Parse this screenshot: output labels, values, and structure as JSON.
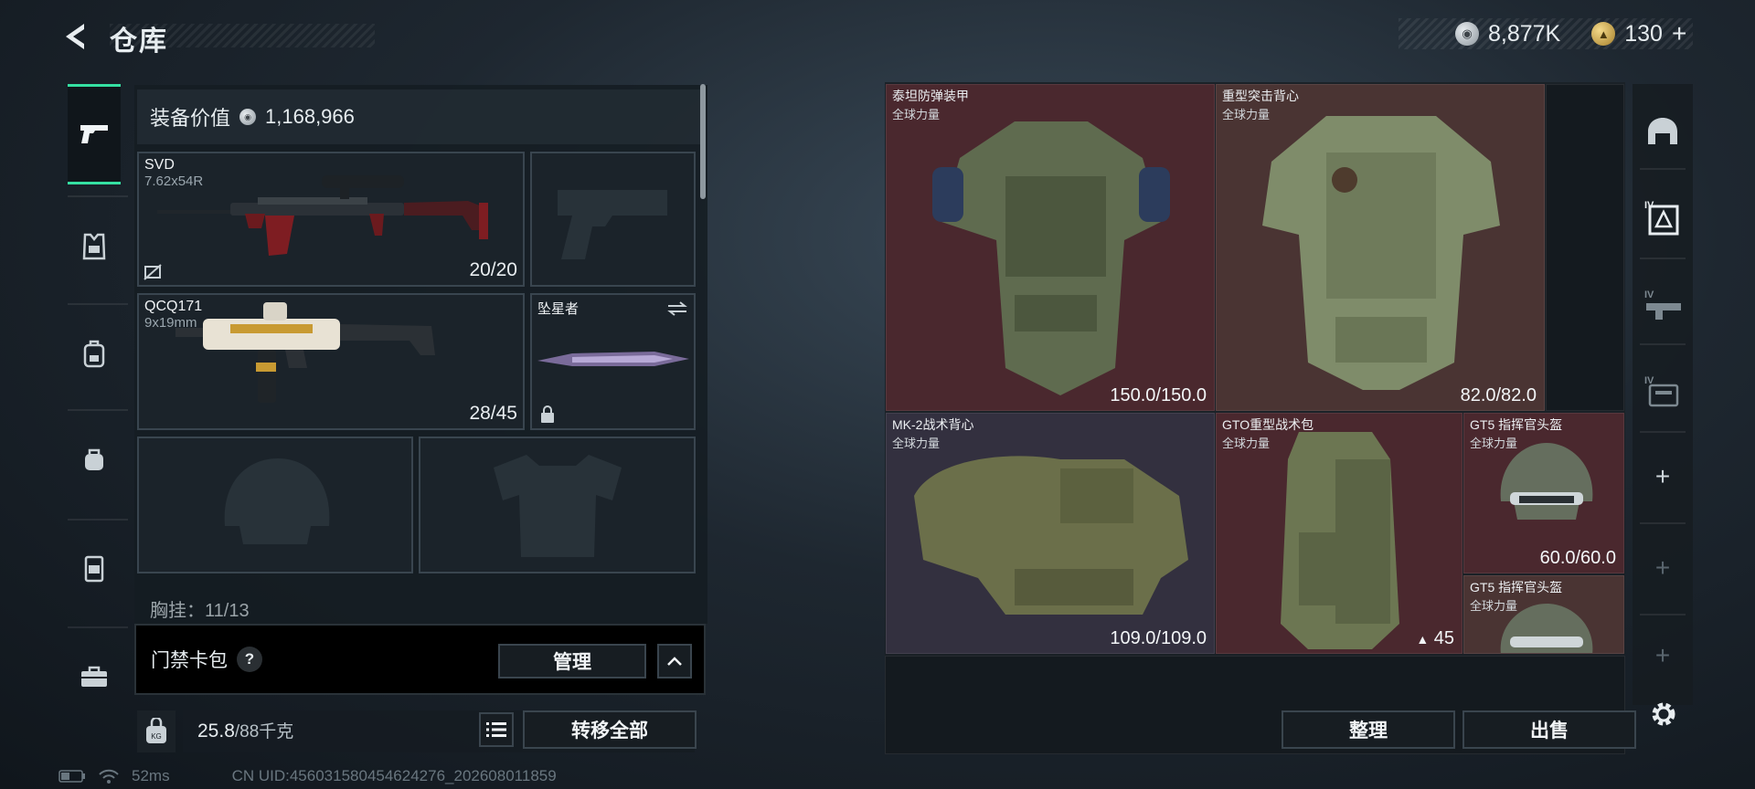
{
  "header": {
    "title": "仓库",
    "currency": [
      {
        "icon": "silver-coin-icon",
        "value": "8,877K"
      },
      {
        "icon": "gold-coin-icon",
        "value": "130"
      }
    ],
    "add_symbol": "+"
  },
  "sidebar": {
    "categories": [
      {
        "icon": "pistol-icon",
        "active": true
      },
      {
        "icon": "armor-vest-icon",
        "active": false
      },
      {
        "icon": "backpack-icon",
        "active": false
      },
      {
        "icon": "pouch-icon",
        "active": false
      },
      {
        "icon": "chest-rig-icon",
        "active": false
      },
      {
        "icon": "toolbox-icon",
        "active": false
      }
    ]
  },
  "loadout": {
    "value_label": "装备价值",
    "value": "1,168,966",
    "primary": {
      "name": "SVD",
      "caliber": "7.62x54R",
      "ammo": "20/20"
    },
    "secondary": {
      "name": "QCQ171",
      "caliber": "9x19mm",
      "ammo": "28/45"
    },
    "melee": {
      "name": "坠星者"
    },
    "chest_label": "胸挂：11/13"
  },
  "keycard": {
    "label": "门禁卡包",
    "help": "?",
    "manage_label": "管理"
  },
  "footer": {
    "weight": "25.8",
    "weight_cap": "/88千克",
    "transfer_label": "转移全部"
  },
  "status": {
    "ping": "52ms",
    "uid": "CN UID:456031580454624276_202608011859"
  },
  "inventory": {
    "items": [
      {
        "name": "泰坦防弹装甲",
        "region": "全球力量",
        "durability": "150.0/150.0"
      },
      {
        "name": "重型突击背心",
        "region": "全球力量",
        "durability": "82.0/82.0"
      },
      {
        "name": "MK-2战术背心",
        "region": "全球力量",
        "durability": "109.0/109.0"
      },
      {
        "name": "GTO重型战术包",
        "region": "全球力量",
        "count": "45"
      },
      {
        "name": "GT5 指挥官头盔",
        "region": "全球力量",
        "durability": "60.0/60.0"
      },
      {
        "name": "GT5 指挥官头盔",
        "region": "全球力量"
      }
    ],
    "sort_label": "整理",
    "sell_label": "出售"
  },
  "filters": {
    "items": [
      {
        "icon": "helmet-filter-icon"
      },
      {
        "icon": "armor-filter-icon",
        "tier": "IV"
      },
      {
        "icon": "rifle-filter-icon",
        "tier": "IV"
      },
      {
        "icon": "bag-filter-icon",
        "tier": "IV"
      },
      {
        "icon": "plus-icon"
      },
      {
        "icon": "plus-icon"
      },
      {
        "icon": "plus-icon"
      }
    ]
  },
  "colors": {
    "accent": "#35e0a2",
    "rarity_red": "#4a282e",
    "rarity_purple": "#33303f"
  }
}
